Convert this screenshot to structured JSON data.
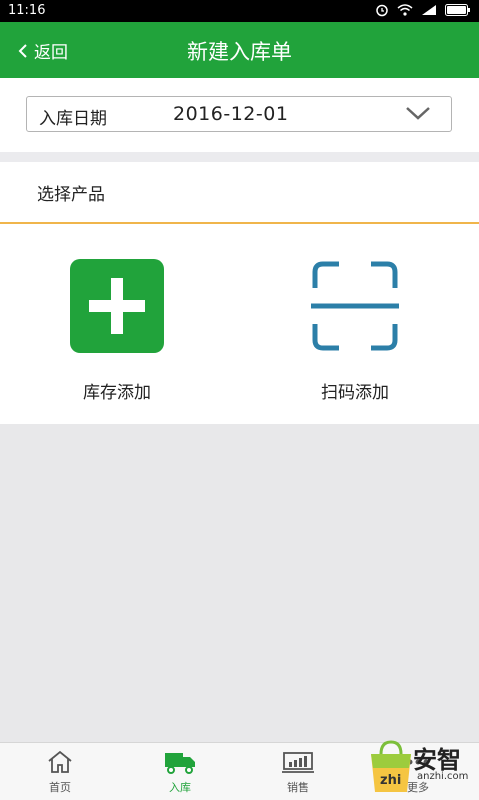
{
  "status_bar": {
    "time": "11:16"
  },
  "header": {
    "back_label": "返回",
    "title": "新建入库单"
  },
  "date_field": {
    "label": "入库日期",
    "value": "2016-12-01"
  },
  "product_section": {
    "title": "选择产品",
    "actions": [
      {
        "label": "库存添加",
        "icon": "add-icon"
      },
      {
        "label": "扫码添加",
        "icon": "scan-icon"
      }
    ]
  },
  "tabs": [
    {
      "label": "首页",
      "icon": "home-icon"
    },
    {
      "label": "入库",
      "icon": "truck-icon",
      "active": true
    },
    {
      "label": "销售",
      "icon": "chart-icon"
    },
    {
      "label": "更多",
      "icon": "more-icon"
    }
  ],
  "watermark": {
    "title": "安智",
    "url": "anzhi.com"
  },
  "colors": {
    "brand_green": "#21a33b",
    "accent_orange": "#f0b54b",
    "scan_blue": "#2c7fa8"
  }
}
